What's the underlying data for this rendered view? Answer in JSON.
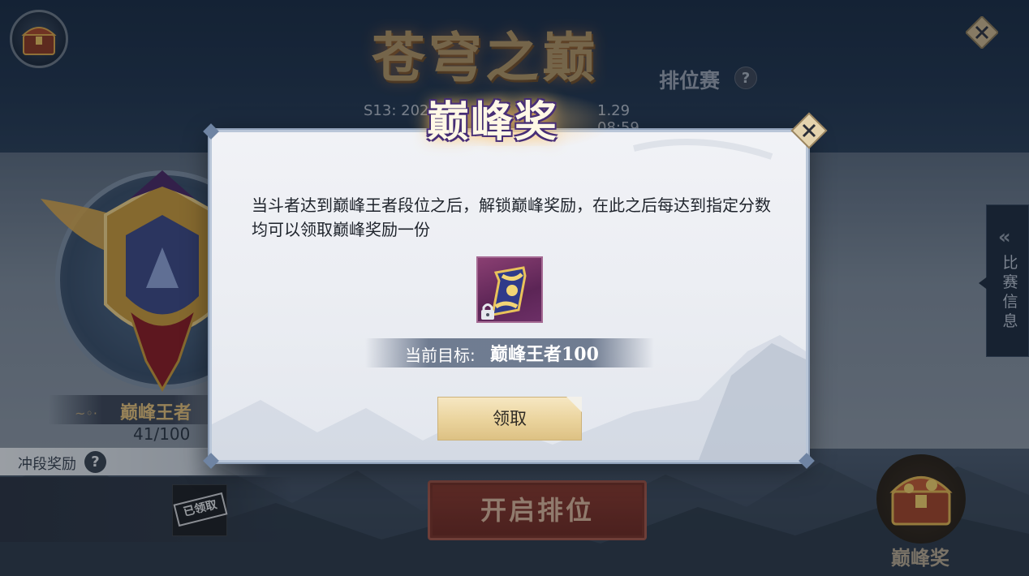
{
  "header": {
    "game_title": "苍穹之巅",
    "mode_label": "排位赛",
    "help_symbol": "?",
    "season_text": "S13: 202",
    "season_end_text": "1.29 08:59",
    "close_symbol": "✕"
  },
  "rank_panel": {
    "rank_name": "巅峰王者",
    "rank_progress": "41/100"
  },
  "reward_bar": {
    "label": "冲段奖励",
    "help_symbol": "?",
    "claimed_stamp": "已领取"
  },
  "start_button": {
    "label": "开启排位"
  },
  "side_tab": {
    "chevron": "«",
    "label": "比赛信息"
  },
  "peak_reward_shortcut": {
    "label": "巅峰奖"
  },
  "modal": {
    "title": "巅峰奖",
    "close_symbol": "✕",
    "description": "当斗者达到巅峰王者段位之后，解锁巅峰奖励，在此之后每达到指定分数均可以领取巅峰奖励一份",
    "reward_item": {
      "icon": "golden-scroll-icon",
      "locked": true
    },
    "target_label": "当前目标:",
    "target_value": "巅峰王者100",
    "claim_button": "领取"
  },
  "colors": {
    "accent_gold": "#e4c17c",
    "start_button_red": "#8a3a2e",
    "modal_bg": "#eceef3",
    "claim_button_gold": "#ead39c"
  }
}
